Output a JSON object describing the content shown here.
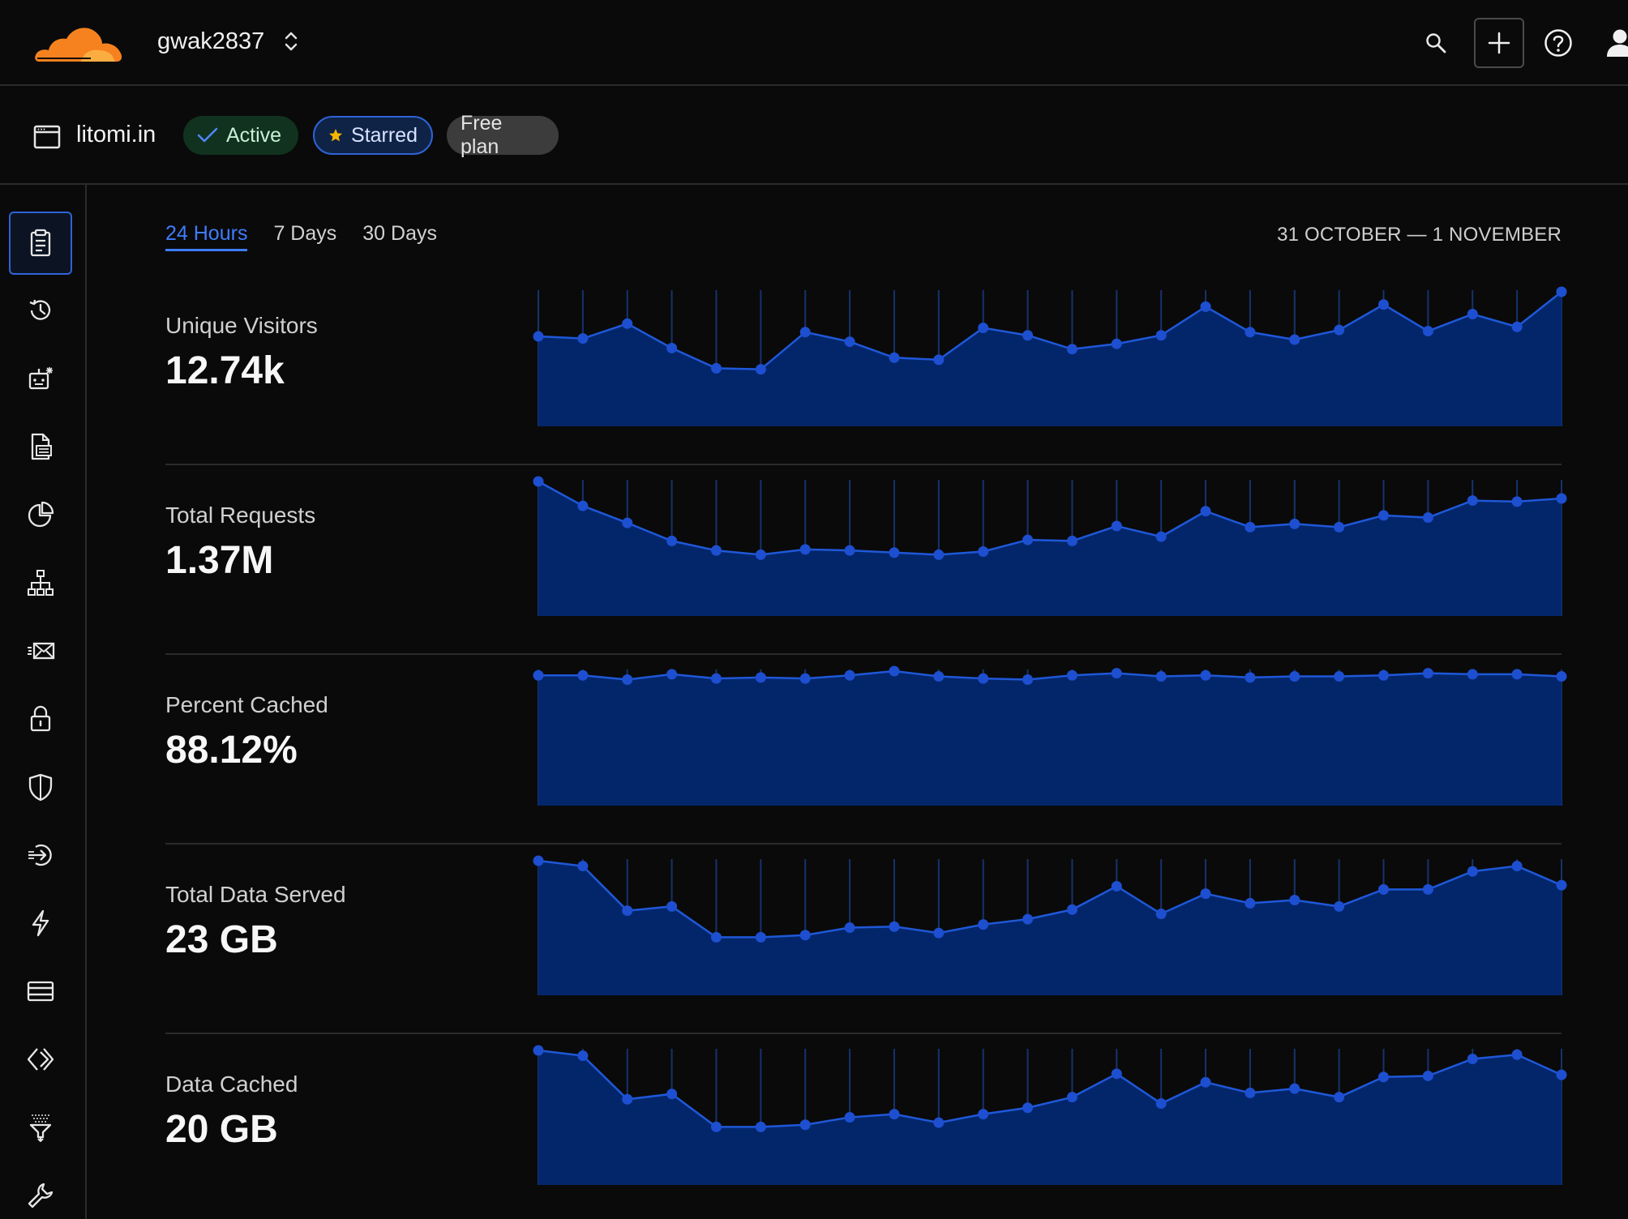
{
  "account": {
    "name": "gwak2837"
  },
  "zone": {
    "name": "litomi.in",
    "badges": {
      "active": "Active",
      "starred": "Starred",
      "plan": "Free plan"
    }
  },
  "tabs": [
    "24 Hours",
    "7 Days",
    "30 Days"
  ],
  "date_range": "31 OCTOBER — 1 NOVEMBER",
  "colors": {
    "accent": "#3e7cff",
    "chart_fill": "#03266b",
    "chart_line": "#1f58d8",
    "chart_point": "#1d4fd0",
    "brand_orange": "#f6821f"
  },
  "metrics": [
    {
      "label": "Unique Visitors",
      "value": "12.74k"
    },
    {
      "label": "Total Requests",
      "value": "1.37M"
    },
    {
      "label": "Percent Cached",
      "value": "88.12%"
    },
    {
      "label": "Total Data Served",
      "value": "23 GB"
    },
    {
      "label": "Data Cached",
      "value": "20 GB"
    }
  ],
  "chart_data": [
    {
      "type": "area",
      "series": [
        {
          "values": [
            58,
            56,
            70,
            47,
            28,
            27,
            62,
            53,
            38,
            36,
            66,
            59,
            46,
            51,
            59,
            86,
            62,
            55,
            64,
            88,
            63,
            79,
            67,
            100
          ]
        }
      ]
    },
    {
      "type": "area",
      "series": [
        {
          "values": [
            100,
            77,
            61,
            44,
            35,
            31,
            36,
            35,
            33,
            31,
            34,
            45,
            44,
            58,
            48,
            72,
            57,
            60,
            57,
            68,
            66,
            82,
            81,
            84
          ]
        }
      ]
    },
    {
      "type": "area",
      "series": [
        {
          "values": [
            96,
            96,
            92,
            97,
            93,
            94,
            93,
            96,
            100,
            95,
            93,
            92,
            96,
            98,
            95,
            96,
            94,
            95,
            95,
            96,
            98,
            97,
            97,
            95
          ]
        }
      ]
    },
    {
      "type": "area",
      "series": [
        {
          "values": [
            100,
            95,
            53,
            57,
            28,
            28,
            30,
            37,
            38,
            32,
            40,
            45,
            54,
            76,
            50,
            69,
            60,
            63,
            57,
            73,
            73,
            90,
            95,
            77
          ]
        }
      ]
    },
    {
      "type": "area",
      "series": [
        {
          "values": [
            100,
            95,
            54,
            59,
            28,
            28,
            30,
            37,
            40,
            32,
            40,
            46,
            56,
            78,
            50,
            70,
            60,
            64,
            56,
            75,
            76,
            92,
            96,
            77
          ]
        }
      ]
    }
  ]
}
